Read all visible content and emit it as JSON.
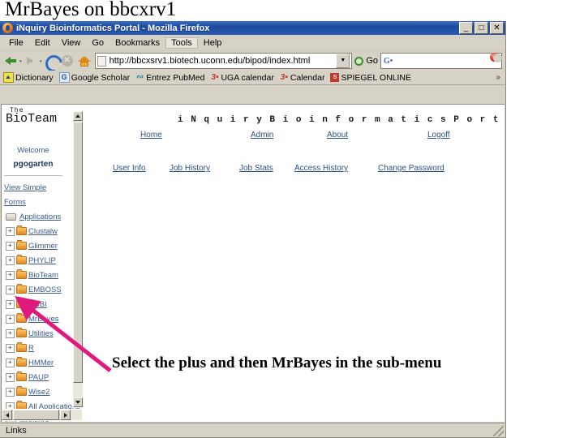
{
  "slide": {
    "title": "MrBayes on bbcxrv1",
    "caption": "Select the plus and then MrBayes in the sub-menu",
    "arrow_color": "#e0197d"
  },
  "browser": {
    "window_title": "iNquiry Bioinformatics Portal - Mozilla Firefox",
    "window_buttons": {
      "minimize": "_",
      "maximize": "□",
      "close": "✕"
    },
    "menus": [
      "File",
      "Edit",
      "View",
      "Go",
      "Bookmarks",
      "Tools",
      "Help"
    ],
    "toolbar": {
      "back": "back-arrow",
      "forward": "forward-arrow",
      "reload": "reload-icon",
      "stop": "stop-icon",
      "home": "home-icon",
      "url": "http://bbcxsrv1.biotech.uconn.edu/bipod/index.html",
      "go_label": "Go",
      "search_placeholder": ""
    },
    "bookmarks": [
      {
        "label": "Dictionary",
        "icon": "dictionary-icon"
      },
      {
        "label": "Google Scholar",
        "icon": "google-scholar-icon"
      },
      {
        "label": "Entrez PubMed",
        "icon": "pubmed-icon"
      },
      {
        "label": "UGA calendar",
        "icon": "uga-calendar-icon"
      },
      {
        "label": "Calendar",
        "icon": "calendar-icon"
      },
      {
        "label": "SPIEGEL ONLINE",
        "icon": "spiegel-icon"
      }
    ],
    "bookmarks_overflow": "»",
    "status": "Links"
  },
  "page": {
    "logo": {
      "line1": "The",
      "line2": "BioTeam"
    },
    "portal_title": "i N q u i r y   B i o i n f o r m a t i c s   P o r t a l",
    "welcome": "Welcome",
    "username": "pgogarten",
    "sidebar_links": [
      "View Simple",
      "Forms"
    ],
    "top_nav": [
      "Home",
      "Admin",
      "About",
      "Logoff"
    ],
    "sub_nav": [
      "User Info",
      "Job History",
      "Job Stats",
      "Access History",
      "Change Password"
    ],
    "tree": [
      {
        "label": "Applications",
        "icon": "monitor-icon",
        "expander": "",
        "indent": false
      },
      {
        "label": "Clustalw",
        "icon": "folder-icon",
        "expander": "+",
        "indent": true
      },
      {
        "label": "Glimmer",
        "icon": "folder-icon",
        "expander": "+",
        "indent": true
      },
      {
        "label": "PHYLIP",
        "icon": "folder-icon",
        "expander": "+",
        "indent": true
      },
      {
        "label": "BioTeam",
        "icon": "folder-icon",
        "expander": "+",
        "indent": true
      },
      {
        "label": "EMBOSS",
        "icon": "folder-icon",
        "expander": "+",
        "indent": true
      },
      {
        "label": "NCBI",
        "icon": "folder-icon",
        "expander": "+",
        "indent": true
      },
      {
        "label": "MrBayes",
        "icon": "folder-icon",
        "expander": "+",
        "indent": true
      },
      {
        "label": "Utilities",
        "icon": "folder-icon",
        "expander": "+",
        "indent": true
      },
      {
        "label": "R",
        "icon": "folder-icon",
        "expander": "+",
        "indent": true
      },
      {
        "label": "HMMer",
        "icon": "folder-icon",
        "expander": "+",
        "indent": true
      },
      {
        "label": "PAUP",
        "icon": "folder-icon",
        "expander": "+",
        "indent": true
      },
      {
        "label": "Wise2",
        "icon": "folder-icon",
        "expander": "+",
        "indent": true
      },
      {
        "label": "All Applications",
        "icon": "folder-icon",
        "expander": "+",
        "indent": true
      },
      {
        "label": "Monitors",
        "icon": "monitor-icon",
        "expander": "",
        "indent": false
      }
    ]
  }
}
